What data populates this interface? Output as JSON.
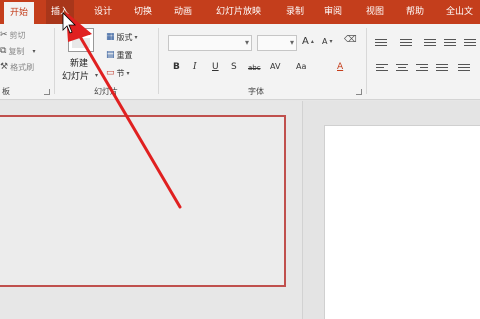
{
  "tabs": {
    "home": "开始",
    "insert": "插入",
    "design": "设计",
    "transitions": "切换",
    "animations": "动画",
    "slideshow": "幻灯片放映",
    "record": "录制",
    "review": "审阅",
    "view": "视图",
    "help": "帮助",
    "wps": "全山文"
  },
  "ribbon": {
    "clipboard": {
      "cut": "剪切",
      "copy": "复制",
      "format_painter": "格式刷",
      "label": "板"
    },
    "slides": {
      "new_slide_line1": "新建",
      "new_slide_line2": "幻灯片",
      "layout": "版式",
      "reset": "重置",
      "section": "节",
      "label": "幻灯片"
    },
    "font": {
      "label": "字体",
      "bold": "B",
      "italic": "I",
      "underline": "U",
      "strikethrough": "S",
      "shadow": "abc",
      "spacing": "AV",
      "case": "Aa",
      "color": "A",
      "grow": "A",
      "shrink": "A"
    }
  },
  "colors": {
    "accent": "#c43e1c",
    "annotation_arrow": "#e02020"
  }
}
